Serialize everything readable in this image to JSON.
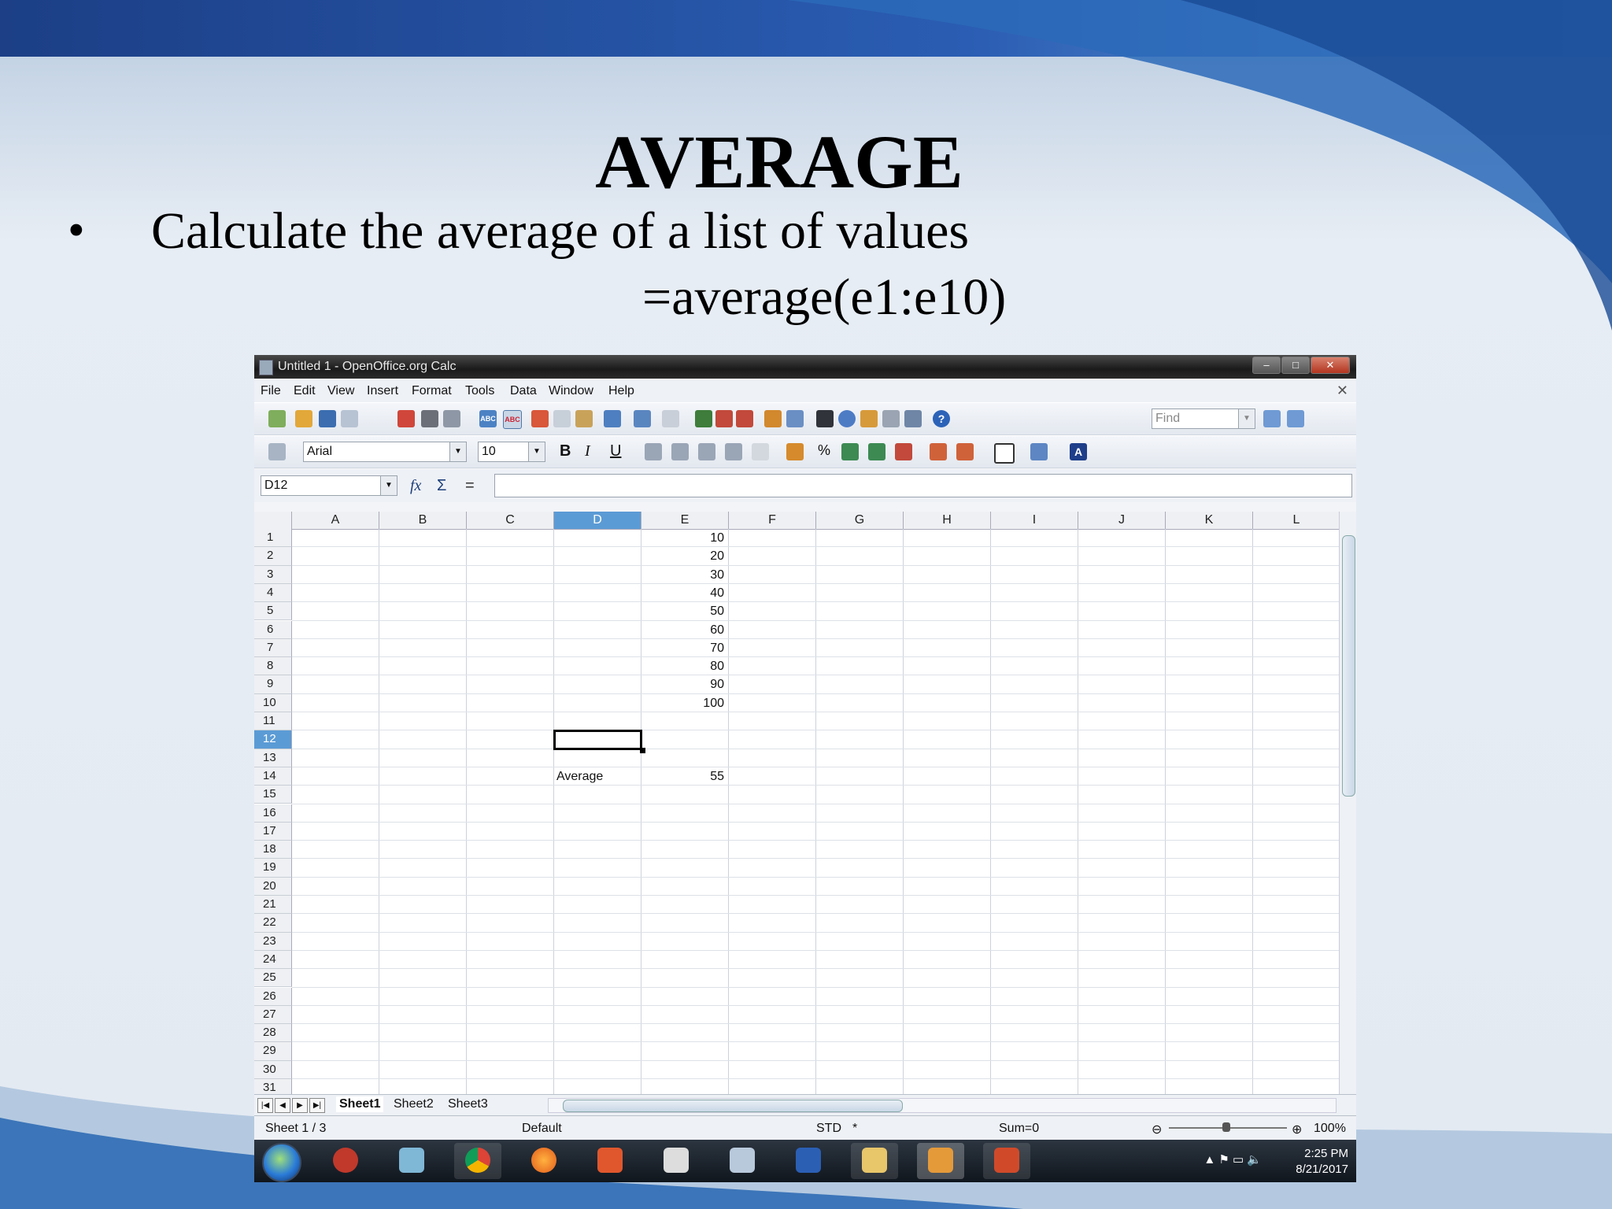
{
  "slide": {
    "title": "AVERAGE",
    "bullet": "•",
    "bullet_text": "Calculate the average of a list of values",
    "formula_text": "=average(e1:e10)"
  },
  "window": {
    "title": "Untitled 1 - OpenOffice.org Calc",
    "buttons": {
      "minimize": "–",
      "maximize": "□",
      "close": "✕"
    }
  },
  "menu": [
    "File",
    "Edit",
    "View",
    "Insert",
    "Format",
    "Tools",
    "Data",
    "Window",
    "Help"
  ],
  "toolbar": {
    "find_placeholder": "Find",
    "font_name": "Arial",
    "font_size": "10",
    "bold": "B",
    "italic": "I",
    "underline": "U",
    "percent": "%"
  },
  "formula_bar": {
    "name_box": "D12",
    "fx_label": "fx",
    "sum_label": "Σ",
    "equals_label": "=",
    "content": ""
  },
  "sheet": {
    "columns": [
      "A",
      "B",
      "C",
      "D",
      "E",
      "F",
      "G",
      "H",
      "I",
      "J",
      "K",
      "L"
    ],
    "selected_column": "D",
    "rows": [
      "1",
      "2",
      "3",
      "4",
      "5",
      "6",
      "7",
      "8",
      "9",
      "10",
      "11",
      "12",
      "13",
      "14",
      "15",
      "16",
      "17",
      "18",
      "19",
      "20",
      "21",
      "22",
      "23",
      "24",
      "25",
      "26",
      "27",
      "28",
      "29",
      "30",
      "31"
    ],
    "selected_row": "12",
    "e_values": [
      "10",
      "20",
      "30",
      "40",
      "50",
      "60",
      "70",
      "80",
      "90",
      "100"
    ],
    "average_label": "Average",
    "average_value": "55"
  },
  "sheet_tabs": [
    "Sheet1",
    "Sheet2",
    "Sheet3"
  ],
  "active_sheet": "Sheet1",
  "status": {
    "sheet_position": "Sheet 1 / 3",
    "page_style": "Default",
    "mode": "STD",
    "modified": "*",
    "sum": "Sum=0",
    "zoom": "100%"
  },
  "taskbar": {
    "time": "2:25 PM",
    "date": "8/21/2017"
  },
  "colors": {
    "selection_header": "#5b9bd5",
    "slide_blue": "#1d4f9c"
  }
}
